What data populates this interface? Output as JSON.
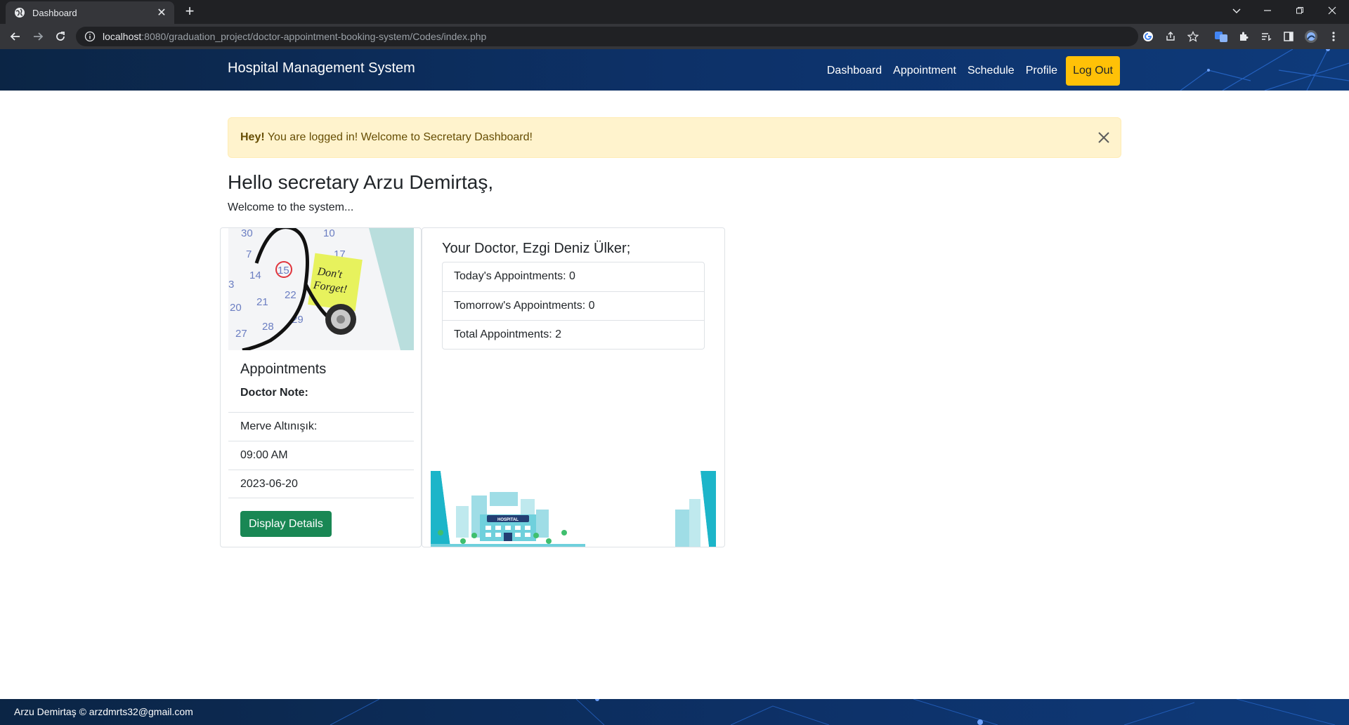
{
  "browser": {
    "tab_title": "Dashboard",
    "url_host": "localhost",
    "url_rest": ":8080/graduation_project/doctor-appointment-booking-system/Codes/index.php"
  },
  "navbar": {
    "brand": "Hospital Management System",
    "links": [
      "Dashboard",
      "Appointment",
      "Schedule",
      "Profile"
    ],
    "logout": "Log Out"
  },
  "alert": {
    "strong": "Hey!",
    "text": " You are logged in! Welcome to Secretary Dashboard!"
  },
  "greeting": {
    "title": "Hello secretary Arzu Demirtaş,",
    "subtitle": "Welcome to the system..."
  },
  "appointments_card": {
    "title": "Appointments",
    "subtitle": "Doctor Note:",
    "items": [
      "Merve Altınışık:",
      "09:00 AM",
      "2023-06-20"
    ],
    "button": "Display Details",
    "image_text": {
      "note_line1": "Don't",
      "note_line2": "Forget!",
      "calendar_numbers": [
        "30",
        "10",
        "7",
        "14",
        "15",
        "17",
        "3",
        "21",
        "22",
        "20",
        "27",
        "28",
        "29"
      ]
    }
  },
  "doctor_card": {
    "title": "Your Doctor, Ezgi Deniz Ülker;",
    "stats": [
      "Today's Appointments: 0",
      "Tomorrow's Appointments: 0",
      "Total Appointments: 2"
    ],
    "hospital_sign": "HOSPITAL"
  },
  "footer": {
    "text": "Arzu Demirtaş © arzdmrts32@gmail.com"
  },
  "colors": {
    "navbar": "#0d3168",
    "logout": "#ffc107",
    "alert_bg": "#fff3cd",
    "details_button": "#198754"
  }
}
